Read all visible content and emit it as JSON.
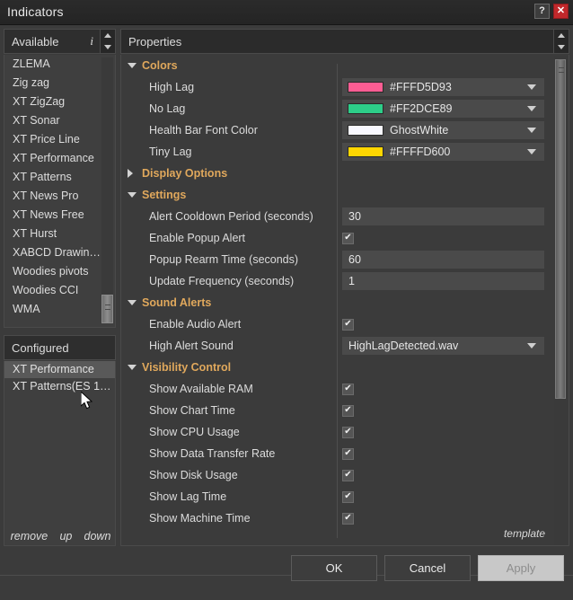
{
  "window": {
    "title": "Indicators",
    "help_label": "?",
    "close_label": "✕"
  },
  "left": {
    "available_header": "Available",
    "info_icon_label": "i",
    "available_items": [
      "WMA",
      "Woodies CCI",
      "Woodies pivots",
      "XABCD Drawin…",
      "XT Hurst",
      "XT News Free",
      "XT News Pro",
      "XT Patterns",
      "XT Performance",
      "XT Price Line",
      "XT Sonar",
      "XT ZigZag",
      "Zig zag",
      "ZLEMA"
    ],
    "configured_header": "Configured",
    "configured_items": [
      {
        "label": "XT Performance",
        "selected": true
      },
      {
        "label": "XT Patterns(ES 1…",
        "selected": false
      }
    ],
    "actions": {
      "remove": "remove",
      "up": "up",
      "down": "down"
    }
  },
  "properties": {
    "header": "Properties",
    "template_label": "template",
    "sections": [
      {
        "name": "Colors",
        "expanded": true,
        "rows": [
          {
            "label": "High Lag",
            "type": "color",
            "value": "#FFFD5D93",
            "swatch": "#FD5D93"
          },
          {
            "label": "No Lag",
            "type": "color",
            "value": "#FF2DCE89",
            "swatch": "#2DCE89"
          },
          {
            "label": "Health Bar Font Color",
            "type": "color",
            "value": "GhostWhite",
            "swatch": "#F8F8FF"
          },
          {
            "label": "Tiny Lag",
            "type": "color",
            "value": "#FFFFD600",
            "swatch": "#FFD600"
          }
        ]
      },
      {
        "name": "Display Options",
        "expanded": false,
        "rows": []
      },
      {
        "name": "Settings",
        "expanded": true,
        "rows": [
          {
            "label": "Alert Cooldown Period (seconds)",
            "type": "text",
            "value": "30"
          },
          {
            "label": "Enable Popup Alert",
            "type": "checkbox",
            "checked": true
          },
          {
            "label": "Popup Rearm Time (seconds)",
            "type": "text",
            "value": "60"
          },
          {
            "label": "Update Frequency (seconds)",
            "type": "text",
            "value": "1"
          }
        ]
      },
      {
        "name": "Sound Alerts",
        "expanded": true,
        "rows": [
          {
            "label": "Enable Audio Alert",
            "type": "checkbox",
            "checked": true
          },
          {
            "label": "High Alert Sound",
            "type": "select",
            "value": "HighLagDetected.wav"
          }
        ]
      },
      {
        "name": "Visibility Control",
        "expanded": true,
        "rows": [
          {
            "label": "Show Available RAM",
            "type": "checkbox",
            "checked": true
          },
          {
            "label": "Show Chart Time",
            "type": "checkbox",
            "checked": true
          },
          {
            "label": "Show CPU Usage",
            "type": "checkbox",
            "checked": true
          },
          {
            "label": "Show Data Transfer Rate",
            "type": "checkbox",
            "checked": true
          },
          {
            "label": "Show Disk Usage",
            "type": "checkbox",
            "checked": true
          },
          {
            "label": "Show Lag Time",
            "type": "checkbox",
            "checked": true
          },
          {
            "label": "Show Machine Time",
            "type": "checkbox",
            "checked": true
          }
        ]
      }
    ],
    "checkmark": "✔"
  },
  "buttons": {
    "ok": "OK",
    "cancel": "Cancel",
    "apply": "Apply"
  },
  "colors": {
    "accent_section": "#E0A85C",
    "close_red": "#C0282B",
    "panel_bg": "#3B3B3B"
  }
}
